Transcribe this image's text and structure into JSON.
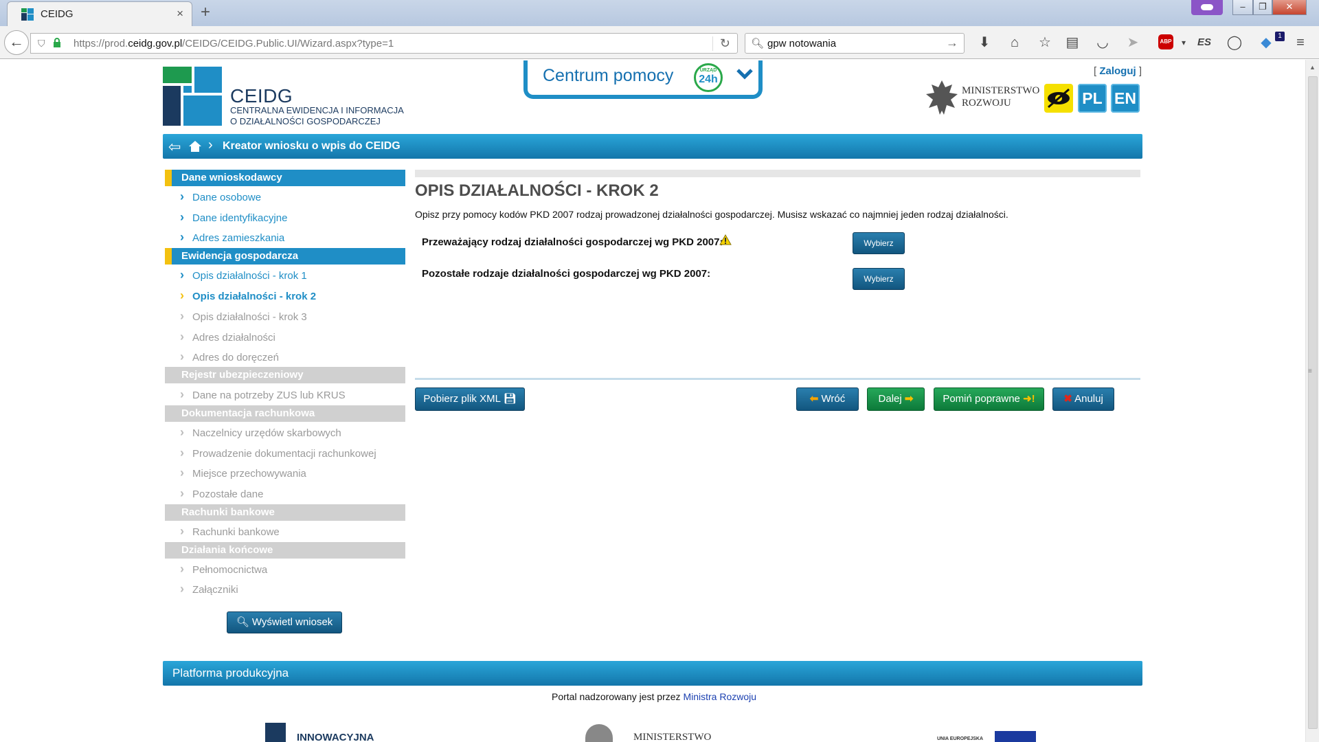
{
  "browser": {
    "tab_title": "CEIDG",
    "tab_close": "×",
    "new_tab": "+",
    "url_prefix": "https://prod.",
    "url_domain": "ceidg.gov.pl",
    "url_suffix": "/CEIDG/CEIDG.Public.UI/Wizard.aspx?type=1",
    "search_value": "gpw notowania",
    "toolbar_icons": [
      "download-icon",
      "home-icon",
      "bookmark-star-icon",
      "reading-list-icon",
      "pocket-icon",
      "send-icon",
      "adblock-icon",
      "es-icon",
      "chat-icon",
      "notification-icon",
      "menu-icon"
    ],
    "adblock_label": "ABP",
    "es_label": "ES",
    "notification_count": "1"
  },
  "header": {
    "logo_title": "CEIDG",
    "logo_sub1": "CENTRALNA EWIDENCJA I INFORMACJA",
    "logo_sub2": "O DZIAŁALNOŚCI GOSPODARCZEJ",
    "help_text": "Centrum pomocy",
    "help_badge_small": "URZĄD",
    "help_badge_big": "24h",
    "login_open": "[ ",
    "login_label": "Zaloguj",
    "login_close": " ]",
    "ministry_line1": "MINISTERSTWO",
    "ministry_line2": "ROZWOJU",
    "lang_pl": "PL",
    "lang_en": "EN",
    "accent_color": "#1f8ec6",
    "highlight_color": "#f3c110"
  },
  "breadcrumb": {
    "title": "Kreator wniosku o wpis do CEIDG"
  },
  "sidebar": {
    "sections": [
      {
        "label": "Dane wnioskodawcy",
        "state": "active",
        "items": [
          {
            "label": "Dane osobowe",
            "state": "enabled"
          },
          {
            "label": "Dane identyfikacyjne",
            "state": "enabled"
          },
          {
            "label": "Adres zamieszkania",
            "state": "enabled"
          }
        ]
      },
      {
        "label": "Ewidencja gospodarcza",
        "state": "active",
        "items": [
          {
            "label": "Opis działalności - krok 1",
            "state": "enabled"
          },
          {
            "label": "Opis działalności - krok 2",
            "state": "current"
          },
          {
            "label": "Opis działalności - krok 3",
            "state": "disabled"
          },
          {
            "label": "Adres działalności",
            "state": "disabled"
          },
          {
            "label": "Adres do doręczeń",
            "state": "disabled"
          }
        ]
      },
      {
        "label": "Rejestr ubezpieczeniowy",
        "state": "inactive",
        "items": [
          {
            "label": "Dane na potrzeby ZUS lub KRUS",
            "state": "disabled"
          }
        ]
      },
      {
        "label": "Dokumentacja rachunkowa",
        "state": "inactive",
        "items": [
          {
            "label": "Naczelnicy urzędów skarbowych",
            "state": "disabled"
          },
          {
            "label": "Prowadzenie dokumentacji rachunkowej",
            "state": "disabled"
          },
          {
            "label": "Miejsce przechowywania",
            "state": "disabled"
          },
          {
            "label": "Pozostałe dane",
            "state": "disabled"
          }
        ]
      },
      {
        "label": "Rachunki bankowe",
        "state": "inactive",
        "items": [
          {
            "label": "Rachunki bankowe",
            "state": "disabled"
          }
        ]
      },
      {
        "label": "Działania końcowe",
        "state": "inactive",
        "items": [
          {
            "label": "Pełnomocnictwa",
            "state": "disabled"
          },
          {
            "label": "Załączniki",
            "state": "disabled"
          }
        ]
      }
    ],
    "show_button": "Wyświetl wniosek"
  },
  "main": {
    "title": "OPIS DZIAŁALNOŚCI - KROK 2",
    "description": "Opisz przy pomocy kodów PKD 2007 rodzaj prowadzonej działalności gospodarczej. Musisz wskazać co najmniej jeden rodzaj działalności.",
    "field1_label": "Przeważający rodzaj działalności gospodarczej wg PKD 2007:",
    "field2_label": "Pozostałe rodzaje działalności gospodarczej wg PKD 2007:",
    "choose_label": "Wybierz",
    "xml_button": "Pobierz plik XML",
    "back_button": "Wróć",
    "next_button": "Dalej",
    "skip_button": "Pomiń poprawne",
    "cancel_button": "Anuluj"
  },
  "footer": {
    "platform": "Platforma produkcyjna",
    "supervised_prefix": "Portal nadzorowany jest przez ",
    "supervised_link": "Ministra Rozwoju",
    "logo1": "INNOWACYJNA",
    "logo2": "MINISTERSTWO",
    "logo3": "UNIA EUROPEJSKA"
  }
}
